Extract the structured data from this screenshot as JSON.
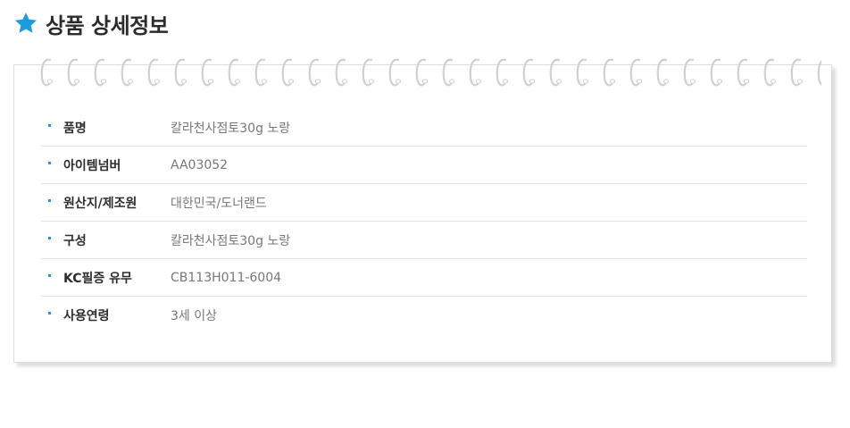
{
  "header": {
    "icon": "star-icon",
    "icon_color": "#1a9cde",
    "title": "상품 상세정보"
  },
  "card": {
    "decoration": "spiral-binding-icon",
    "accent_color": "#1a9cde",
    "rows": [
      {
        "label": "품명",
        "value": "칼라천사점토30g 노랑"
      },
      {
        "label": "아이템넘버",
        "value": "AA03052"
      },
      {
        "label": "원산지/제조원",
        "value": "대한민국/도너랜드"
      },
      {
        "label": "구성",
        "value": "칼라천사점토30g 노랑"
      },
      {
        "label": "KC필증 유무",
        "value": "CB113H011-6004"
      },
      {
        "label": "사용연령",
        "value": "3세 이상"
      }
    ]
  }
}
